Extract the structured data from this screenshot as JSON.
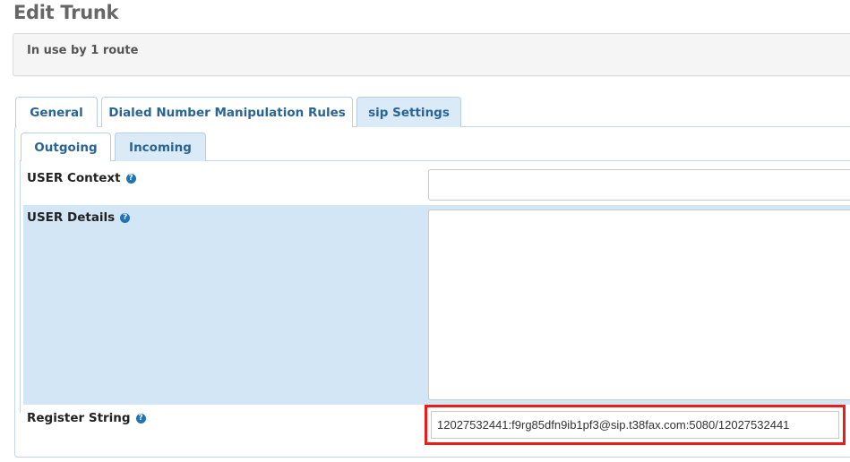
{
  "page": {
    "title": "Edit Trunk"
  },
  "usage": {
    "text": "In use by 1 route"
  },
  "tabs": [
    {
      "label": "General"
    },
    {
      "label": "Dialed Number Manipulation Rules"
    },
    {
      "label": "sip Settings"
    }
  ],
  "subtabs": [
    {
      "label": "Outgoing"
    },
    {
      "label": "Incoming"
    }
  ],
  "fields": {
    "user_context": {
      "label": "USER Context",
      "value": ""
    },
    "user_details": {
      "label": "USER Details",
      "value": ""
    },
    "register_string": {
      "label": "Register String",
      "value": "12027532441:f9rg85dfn9ib1pf3@sip.t38fax.com:5080/12027532441"
    }
  },
  "help_icon_glyph": "?",
  "colors": {
    "tab_text": "#2a6496",
    "highlight_row": "#d2e6f6",
    "annotation": "#ee1c17"
  }
}
